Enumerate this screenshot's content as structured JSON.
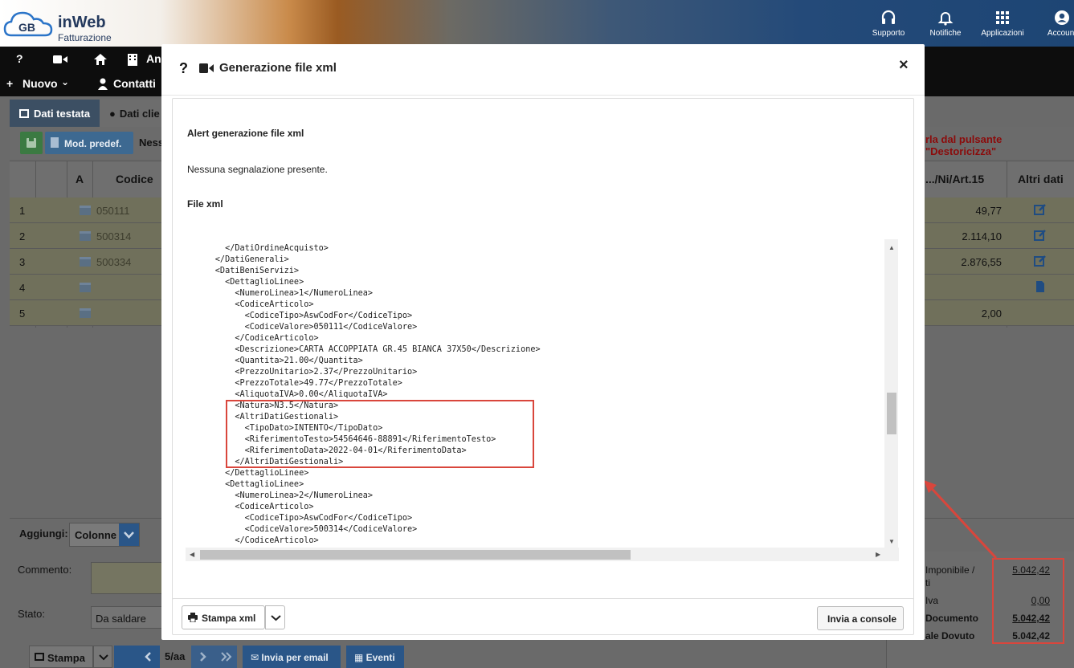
{
  "app": {
    "brand_name": "inWeb",
    "brand_sub": "Fatturazione",
    "logo_letters": "GB"
  },
  "topnav": [
    {
      "label": "Supporto",
      "icon": "headset-icon"
    },
    {
      "label": "Notifiche",
      "icon": "bell-icon"
    },
    {
      "label": "Applicazioni",
      "icon": "grid-icon"
    },
    {
      "label": "Account",
      "icon": "user-icon"
    }
  ],
  "navbar": {
    "help": "?",
    "an": "An",
    "nuovo": "Nuovo",
    "contatti": "Contatti"
  },
  "tabs": [
    {
      "label": "Dati testata"
    },
    {
      "label": "Dati clie"
    }
  ],
  "toolbar": {
    "mod_predef": "Mod. predef.",
    "ness": "Ness",
    "dest_warning": "rla dal pulsante \"Destoricizza\""
  },
  "grid": {
    "headers": {
      "a": "A",
      "codice": "Codice",
      "col_art": ".../Ni/Art.15",
      "altri": "Altri dati"
    },
    "rows": [
      {
        "num": "1",
        "code": "050111",
        "value": "49,77",
        "extra": "edit"
      },
      {
        "num": "2",
        "code": "500314",
        "value": "2.114,10",
        "extra": "edit"
      },
      {
        "num": "3",
        "code": "500334",
        "value": "2.876,55",
        "extra": "edit"
      },
      {
        "num": "4",
        "code": "",
        "value": "",
        "extra": "doc"
      },
      {
        "num": "5",
        "code": "",
        "value": "2,00",
        "extra": ""
      }
    ]
  },
  "aggiungi": {
    "label": "Aggiungi:",
    "select": "Colonne"
  },
  "form": {
    "commento_label": "Commento:",
    "stato_label": "Stato:",
    "stato_value": "Da saldare"
  },
  "bottom": {
    "stampa": "Stampa",
    "page": "5/aa",
    "email": "Invia per email",
    "eventi": "Eventi"
  },
  "totals": [
    {
      "label": "Imponibile /",
      "label2": "ti",
      "value": "5.042,42"
    },
    {
      "label": "Iva",
      "value": "0,00"
    },
    {
      "label": "Documento",
      "value": "5.042,42"
    },
    {
      "label": "ale Dovuto",
      "value": "5.042,42"
    }
  ],
  "modal": {
    "help": "?",
    "title": "Generazione file xml",
    "close": "×",
    "alert_title": "Alert generazione file xml",
    "alert_text": "Nessuna segnalazione presente.",
    "xml_title": "File xml",
    "xml_lines": [
      "        </DatiOrdineAcquisto>",
      "      </DatiGenerali>",
      "      <DatiBeniServizi>",
      "        <DettaglioLinee>",
      "          <NumeroLinea>1</NumeroLinea>",
      "          <CodiceArticolo>",
      "            <CodiceTipo>AswCodFor</CodiceTipo>",
      "            <CodiceValore>050111</CodiceValore>",
      "          </CodiceArticolo>",
      "          <Descrizione>CARTA ACCOPPIATA GR.45 BIANCA 37X50</Descrizione>",
      "          <Quantita>21.00</Quantita>",
      "          <PrezzoUnitario>2.37</PrezzoUnitario>",
      "          <PrezzoTotale>49.77</PrezzoTotale>",
      "          <AliquotaIVA>0.00</AliquotaIVA>",
      "          <Natura>N3.5</Natura>",
      "          <AltriDatiGestionali>",
      "            <TipoDato>INTENTO</TipoDato>",
      "            <RiferimentoTesto>54564646-88891</RiferimentoTesto>",
      "            <RiferimentoData>2022-04-01</RiferimentoData>",
      "          </AltriDatiGestionali>",
      "        </DettaglioLinee>",
      "        <DettaglioLinee>",
      "          <NumeroLinea>2</NumeroLinea>",
      "          <CodiceArticolo>",
      "            <CodiceTipo>AswCodFor</CodiceTipo>",
      "            <CodiceValore>500314</CodiceValore>",
      "          </CodiceArticolo>"
    ],
    "stampa_xml": "Stampa xml",
    "invia_console": "Invia a console"
  },
  "colors": {
    "accent_blue": "#2a5688",
    "highlight_red": "#d9463c",
    "navbar": "#0d0d0d"
  }
}
